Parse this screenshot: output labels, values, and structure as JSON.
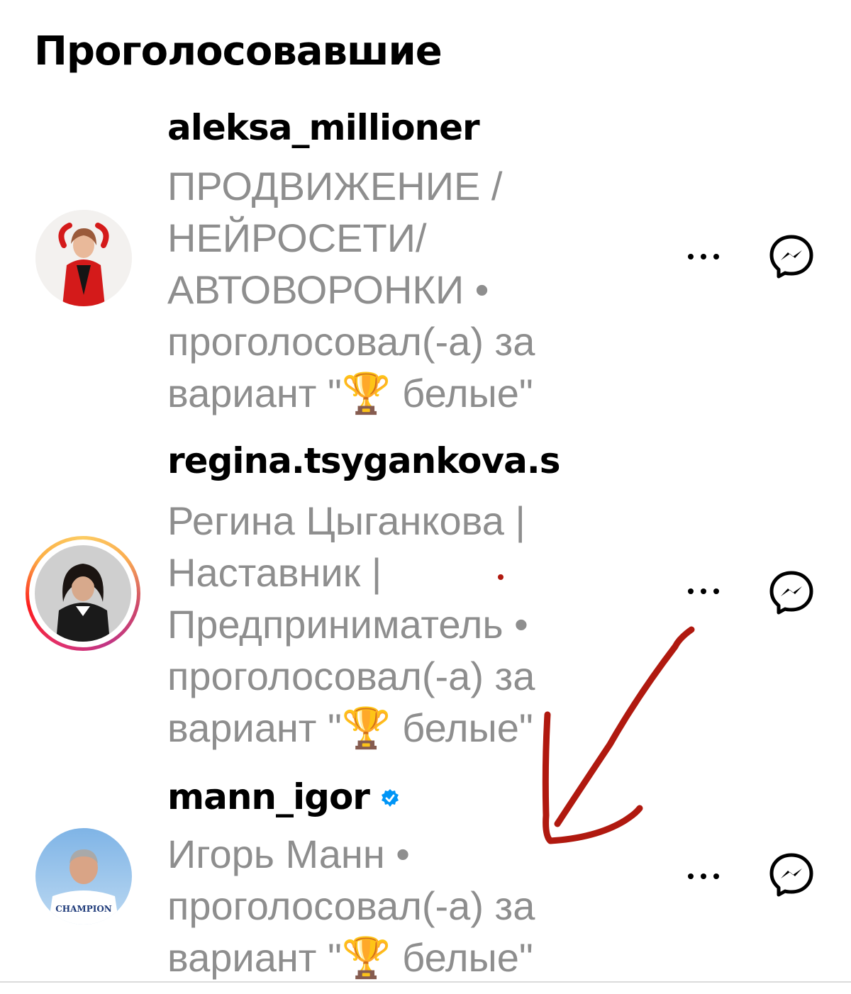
{
  "header": {
    "title": "Проголосовавшие"
  },
  "voters": [
    {
      "username": "aleksa_millioner",
      "verified": false,
      "story_ring": false,
      "bio_lines": [
        "ПРОДВИЖЕНИЕ /",
        "НЕЙРОСЕТИ/",
        "АВТОВОРОНКИ •"
      ],
      "vote_line_1": "проголосовал(-а) за",
      "vote_line_2": "вариант \"🏆 белые\"",
      "avatar_icon": "avatar-woman-red-jacket",
      "more_icon": "more-dots-icon",
      "message_icon": "messenger-icon"
    },
    {
      "username": "regina.tsygankova.s",
      "verified": false,
      "story_ring": true,
      "bio_lines": [
        "Регина Цыганкова |",
        "Наставник |",
        "Предприниматель •"
      ],
      "vote_line_1": "проголосовал(-а) за",
      "vote_line_2": "вариант \"🏆 белые\"",
      "avatar_icon": "avatar-woman-dark-hair",
      "more_icon": "more-dots-icon",
      "message_icon": "messenger-icon"
    },
    {
      "username": "mann_igor",
      "verified": true,
      "story_ring": false,
      "bio_lines": [
        "Игорь Манн •"
      ],
      "vote_line_1": "проголосовал(-а) за",
      "vote_line_2": "вариант \"🏆 белые\"",
      "avatar_icon": "avatar-man-champion-shirt",
      "avatar_shirt_text": "CHAMPION",
      "more_icon": "more-dots-icon",
      "message_icon": "messenger-icon"
    }
  ],
  "annotation": {
    "arrow_color": "#b0190f",
    "arrow_icon": "hand-drawn-arrow-icon"
  },
  "colors": {
    "primary_text": "#000000",
    "secondary_text": "#8e8e8e",
    "verified_blue": "#0095f6"
  }
}
